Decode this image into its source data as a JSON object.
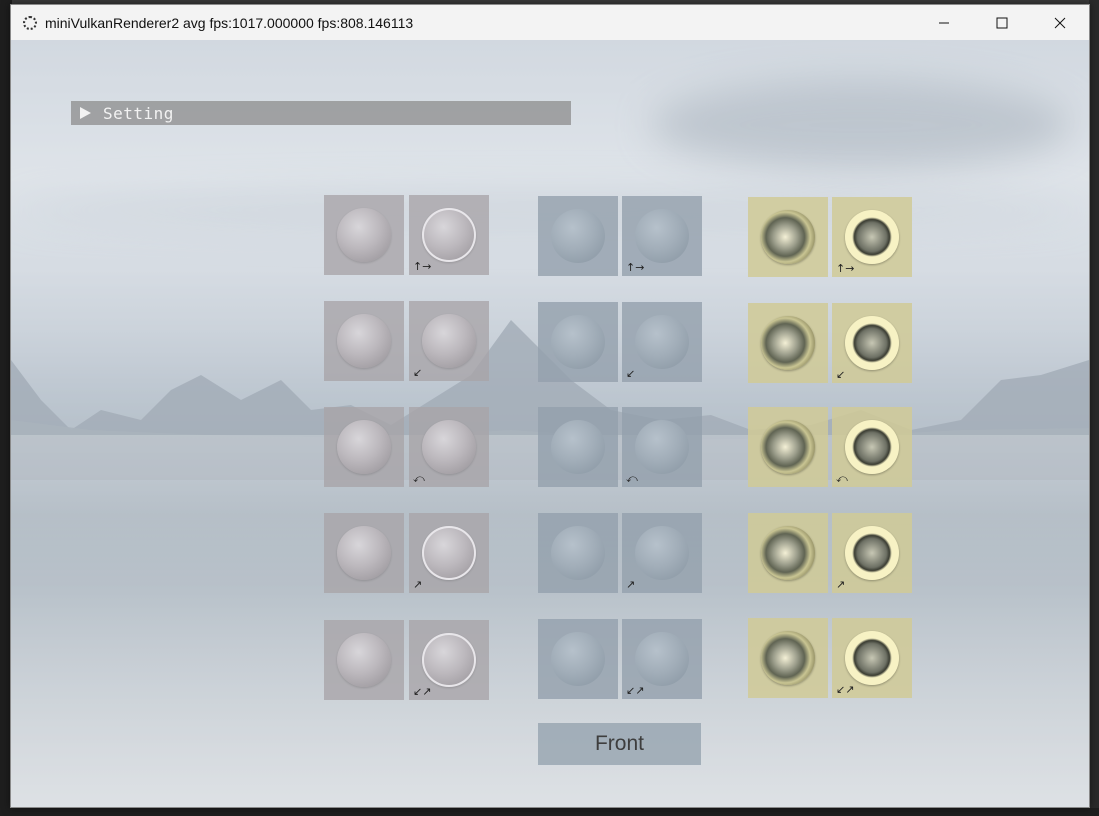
{
  "window": {
    "title": "miniVulkanRenderer2 avg fps:1017.000000 fps:808.146113",
    "controls": [
      "minimize-icon",
      "maximize-icon",
      "close-icon"
    ]
  },
  "setting_panel": {
    "label": "Setting",
    "state": "collapsed"
  },
  "material_grid": {
    "groups": [
      {
        "name": "group-1",
        "color": "#a8a4a8"
      },
      {
        "name": "group-2",
        "color": "#94a0ac"
      },
      {
        "name": "group-3",
        "color": "#d0ca96"
      }
    ],
    "row_direction_glyphs": [
      "↑→",
      "↙",
      "⤺",
      "↗",
      "↙↗"
    ]
  },
  "front_button": {
    "label": "Front"
  }
}
